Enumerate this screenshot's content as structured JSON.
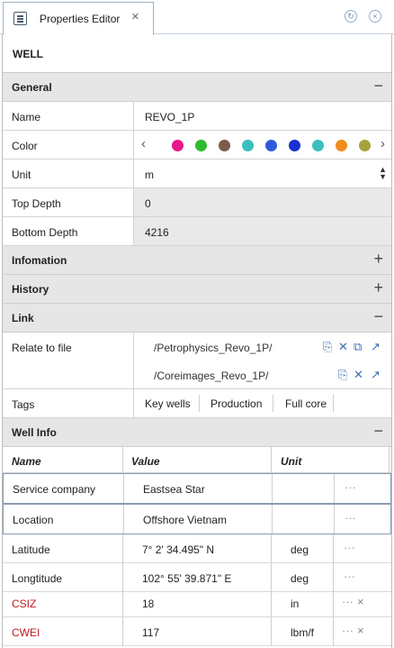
{
  "tab": {
    "title": "Properties Editor",
    "close": "×",
    "icon": "list-icon"
  },
  "window": {
    "refresh_icon": "refresh-icon",
    "close_icon": "close-circle-icon"
  },
  "object_title": "WELL",
  "sections": {
    "general": {
      "label": "General",
      "toggle": "−"
    },
    "information": {
      "label": "Infomation",
      "toggle": "+"
    },
    "history": {
      "label": "History",
      "toggle": "+"
    },
    "link": {
      "label": "Link",
      "toggle": "−"
    },
    "well_info": {
      "label": "Well Info",
      "toggle": "−"
    }
  },
  "general": {
    "name": {
      "label": "Name",
      "value": "REVO_1P"
    },
    "color": {
      "label": "Color",
      "swatches": [
        "#e6198c",
        "#2dbb2d",
        "#7d5a4a",
        "#3bbfbf",
        "#2e5bd9",
        "#1a2fd0",
        "#3bbfbf",
        "#f08c1a",
        "#a8a23a"
      ]
    },
    "unit": {
      "label": "Unit",
      "value": "m"
    },
    "top_depth": {
      "label": "Top Depth",
      "value": "0"
    },
    "bottom_depth": {
      "label": "Bottom Depth",
      "value": "4216"
    }
  },
  "link": {
    "relate_label": "Relate to file",
    "files": [
      "/Petrophysics_Revo_1P/",
      "/Coreimages_Revo_1P/"
    ],
    "tags_label": "Tags",
    "tags": [
      "Key wells",
      "Production",
      "Full core"
    ]
  },
  "well_info": {
    "columns": {
      "name": "Name",
      "value": "Value",
      "unit": "Unit"
    },
    "rows": [
      {
        "name": "Service company",
        "value": "Eastsea Star",
        "unit": "",
        "red": false
      },
      {
        "name": "Location",
        "value": "Offshore Vietnam",
        "unit": "",
        "red": false
      },
      {
        "name": "Latitude",
        "value": "7° 2' 34.495\" N",
        "unit": "deg",
        "red": false
      },
      {
        "name": "Longtitude",
        "value": "102° 55' 39.871\" E",
        "unit": "deg",
        "red": false
      },
      {
        "name": "CSIZ",
        "value": "18",
        "unit": "in",
        "red": true
      },
      {
        "name": "CWEI",
        "value": "117",
        "unit": "lbm/f",
        "red": true
      }
    ],
    "more_label": "···",
    "delete_label": "×"
  }
}
